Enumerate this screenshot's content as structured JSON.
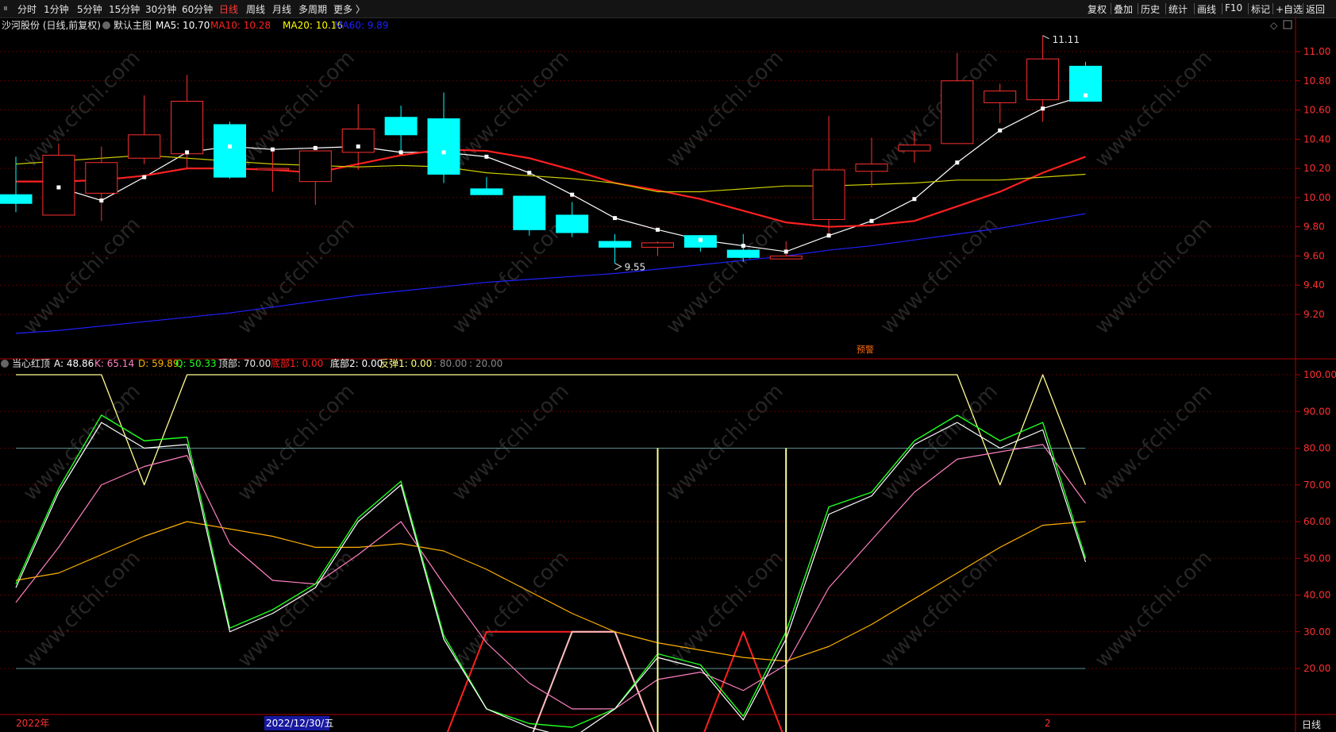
{
  "toolbar": {
    "left_items": [
      "分时",
      "1分钟",
      "5分钟",
      "15分钟",
      "30分钟",
      "60分钟",
      "日线",
      "周线",
      "月线",
      "多周期",
      "更多 〉"
    ],
    "active": "日线",
    "right_items": [
      "复权",
      "叠加",
      "历史",
      "统计",
      "画线",
      "F10",
      "标记",
      "+自选",
      "返回"
    ]
  },
  "main_legend": [
    {
      "text": "沙河股份 (日线,前复权)",
      "color": "#e6e6e6"
    },
    {
      "text": "默认主图",
      "color": "#e6e6e6"
    },
    {
      "text": "MA5: 10.70",
      "color": "#ffffff"
    },
    {
      "text": "MA10: 10.28",
      "color": "#ff2020"
    },
    {
      "text": "MA20: 10.16",
      "color": "#ffff00"
    },
    {
      "text": "MA60: 9.89",
      "color": "#2020ff"
    }
  ],
  "indicator_legend": [
    {
      "text": "当心红顶",
      "color": "#e6e6e6"
    },
    {
      "text": "A: 48.86",
      "color": "#ffffff"
    },
    {
      "text": "K: 65.14",
      "color": "#ff80c0"
    },
    {
      "text": "D: 59.89",
      "color": "#ffb000"
    },
    {
      "text": "Q: 50.33",
      "color": "#20ff20"
    },
    {
      "text": "顶部: 70.00",
      "color": "#e6e6e6"
    },
    {
      "text": "底部1: 0.00",
      "color": "#ff2020"
    },
    {
      "text": "底部2: 0.00",
      "color": "#ffffff"
    },
    {
      "text": "反弹1: 0.00",
      "color": "#ffff80"
    },
    {
      "text": ": 80.00",
      "color": "#888888"
    },
    {
      "text": ": 20.00",
      "color": "#888888"
    }
  ],
  "bottom_axis": {
    "left": "2022年",
    "date": "2022/12/30/五",
    "mid": "2",
    "right": "日线"
  },
  "annotations": {
    "high": "11.11",
    "low": "9.55",
    "signal": "预警"
  },
  "watermark": "www.cfchi.com",
  "colors": {
    "up": "#ff3030",
    "down": "#00ffff",
    "ma5": "#ffffff",
    "ma10": "#ff2020",
    "ma20": "#cccc00",
    "ma60": "#2020ff",
    "axis": "#b00000"
  },
  "chart_data": [
    {
      "type": "candlestick",
      "title": "沙河股份 (日线,前复权)",
      "ylim": [
        9.05,
        11.08
      ],
      "yticks": [
        9.2,
        9.4,
        9.6,
        9.8,
        10.0,
        10.2,
        10.4,
        10.6,
        10.8,
        11.0
      ],
      "candles": [
        {
          "o": 10.02,
          "c": 9.96,
          "h": 10.28,
          "l": 9.9
        },
        {
          "o": 9.88,
          "c": 10.29,
          "h": 10.37,
          "l": 9.88
        },
        {
          "o": 10.03,
          "c": 10.24,
          "h": 10.35,
          "l": 9.84
        },
        {
          "o": 10.27,
          "c": 10.43,
          "h": 10.7,
          "l": 10.23
        },
        {
          "o": 10.3,
          "c": 10.66,
          "h": 10.84,
          "l": 10.2
        },
        {
          "o": 10.5,
          "c": 10.14,
          "h": 10.52,
          "l": 10.13
        },
        {
          "o": 10.19,
          "c": 10.2,
          "h": 10.32,
          "l": 10.04
        },
        {
          "o": 10.11,
          "c": 10.32,
          "h": 10.32,
          "l": 9.95
        },
        {
          "o": 10.31,
          "c": 10.47,
          "h": 10.64,
          "l": 10.19
        },
        {
          "o": 10.55,
          "c": 10.43,
          "h": 10.63,
          "l": 10.3
        },
        {
          "o": 10.54,
          "c": 10.16,
          "h": 10.72,
          "l": 10.1
        },
        {
          "o": 10.06,
          "c": 10.02,
          "h": 10.14,
          "l": 10.02
        },
        {
          "o": 10.01,
          "c": 9.78,
          "h": 10.01,
          "l": 9.74
        },
        {
          "o": 9.88,
          "c": 9.76,
          "h": 9.97,
          "l": 9.73
        },
        {
          "o": 9.7,
          "c": 9.66,
          "h": 9.75,
          "l": 9.55
        },
        {
          "o": 9.66,
          "c": 9.69,
          "h": 9.7,
          "l": 9.6
        },
        {
          "o": 9.74,
          "c": 9.66,
          "h": 9.74,
          "l": 9.63
        },
        {
          "o": 9.64,
          "c": 9.59,
          "h": 9.75,
          "l": 9.56
        },
        {
          "o": 9.58,
          "c": 9.6,
          "h": 9.7,
          "l": 9.58
        },
        {
          "o": 9.85,
          "c": 10.19,
          "h": 10.56,
          "l": 9.74
        },
        {
          "o": 10.18,
          "c": 10.23,
          "h": 10.41,
          "l": 10.07
        },
        {
          "o": 10.32,
          "c": 10.36,
          "h": 10.45,
          "l": 10.24
        },
        {
          "o": 10.37,
          "c": 10.8,
          "h": 10.99,
          "l": 10.37
        },
        {
          "o": 10.65,
          "c": 10.73,
          "h": 10.78,
          "l": 10.51
        },
        {
          "o": 10.67,
          "c": 10.95,
          "h": 11.11,
          "l": 10.52
        },
        {
          "o": 10.9,
          "c": 10.66,
          "h": 10.93,
          "l": 10.66
        }
      ],
      "series": [
        {
          "name": "MA5",
          "values": [
            null,
            10.07,
            9.98,
            10.14,
            10.31,
            10.35,
            10.33,
            10.34,
            10.35,
            10.31,
            10.31,
            10.28,
            10.17,
            10.02,
            9.86,
            9.78,
            9.71,
            9.67,
            9.63,
            9.74,
            9.84,
            9.99,
            10.24,
            10.46,
            10.61,
            10.7
          ]
        },
        {
          "name": "MA10",
          "values": [
            10.11,
            10.11,
            10.12,
            10.15,
            10.2,
            10.2,
            10.19,
            10.17,
            10.23,
            10.29,
            10.33,
            10.32,
            10.27,
            10.19,
            10.1,
            10.05,
            9.99,
            9.91,
            9.83,
            9.8,
            9.81,
            9.84,
            9.94,
            10.04,
            10.17,
            10.28
          ]
        },
        {
          "name": "MA20",
          "values": [
            10.23,
            10.25,
            10.27,
            10.29,
            10.27,
            10.25,
            10.23,
            10.22,
            10.21,
            10.22,
            10.21,
            10.17,
            10.15,
            10.13,
            10.1,
            10.04,
            10.04,
            10.06,
            10.08,
            10.08,
            10.09,
            10.1,
            10.12,
            10.12,
            10.14,
            10.16
          ]
        },
        {
          "name": "MA60",
          "values": [
            9.07,
            9.09,
            9.12,
            9.15,
            9.18,
            9.21,
            9.25,
            9.29,
            9.33,
            9.36,
            9.39,
            9.42,
            9.44,
            9.46,
            9.48,
            9.51,
            9.54,
            9.57,
            9.6,
            9.64,
            9.67,
            9.71,
            9.75,
            9.79,
            9.84,
            9.89
          ]
        }
      ]
    },
    {
      "type": "line",
      "title": "当心红顶",
      "ylim": [
        0,
        102
      ],
      "yticks": [
        20,
        30,
        40,
        50,
        60,
        70,
        80,
        90,
        100
      ],
      "reference_lines": [
        80,
        20
      ],
      "series": [
        {
          "name": "A",
          "values": [
            42,
            68,
            87,
            80,
            81,
            30,
            35,
            42,
            60,
            70,
            28,
            9,
            4,
            1,
            9,
            23,
            20,
            6,
            28,
            62,
            67,
            81,
            87,
            80,
            85,
            49
          ]
        },
        {
          "name": "K",
          "values": [
            38,
            53,
            70,
            75,
            78,
            54,
            44,
            43,
            51,
            60,
            43,
            27,
            16,
            9,
            9,
            17,
            19,
            14,
            21,
            42,
            55,
            68,
            77,
            79,
            81,
            65
          ]
        },
        {
          "name": "D",
          "values": [
            44,
            46,
            51,
            56,
            60,
            58,
            56,
            53,
            53,
            54,
            52,
            47,
            41,
            35,
            30,
            27,
            25,
            23,
            22,
            26,
            32,
            39,
            46,
            53,
            59,
            60
          ]
        },
        {
          "name": "Q",
          "values": [
            43,
            69,
            89,
            82,
            83,
            31,
            36,
            43,
            61,
            71,
            29,
            9,
            5,
            4,
            9,
            24,
            21,
            7,
            30,
            64,
            68,
            82,
            89,
            82,
            87,
            50
          ]
        },
        {
          "name": "顶部",
          "values": [
            100,
            100,
            100,
            70,
            100,
            100,
            100,
            100,
            100,
            100,
            100,
            100,
            100,
            100,
            100,
            100,
            100,
            100,
            100,
            100,
            100,
            100,
            100,
            70,
            100,
            70
          ]
        },
        {
          "name": "底部1",
          "values": [
            0,
            0,
            0,
            0,
            0,
            0,
            0,
            0,
            0,
            0,
            0,
            30,
            30,
            30,
            30,
            0,
            0,
            30,
            0,
            0,
            0,
            0,
            0,
            0,
            0,
            0
          ]
        },
        {
          "name": "底部2",
          "values": [
            0,
            0,
            0,
            0,
            0,
            0,
            0,
            0,
            0,
            0,
            0,
            0,
            0,
            30,
            30,
            0,
            0,
            0,
            0,
            0,
            0,
            0,
            0,
            0,
            0,
            0
          ]
        },
        {
          "name": "反弹1",
          "values": [
            0,
            0,
            0,
            0,
            0,
            0,
            0,
            0,
            0,
            0,
            0,
            0,
            0,
            0,
            0,
            80,
            0,
            0,
            80,
            0,
            0,
            0,
            0,
            0,
            0,
            0
          ]
        }
      ]
    }
  ]
}
